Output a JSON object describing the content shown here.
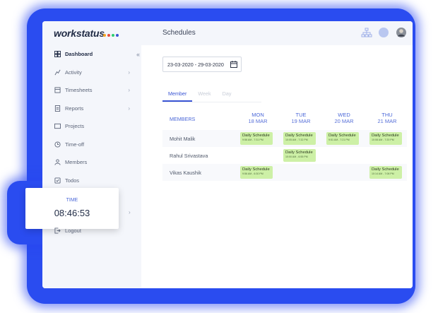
{
  "brand": {
    "logo_text": "workstatus",
    "dot_colors": [
      "#f5a623",
      "#e74c3c",
      "#2ecc71",
      "#3a55d4"
    ]
  },
  "colors": {
    "accent": "#3a55d4",
    "glow": "#2a4cf0",
    "schedule_chip": "#cdf0a6"
  },
  "sidebar": {
    "items": [
      {
        "label": "Dashboard",
        "icon": "dashboard-icon",
        "active": true
      },
      {
        "label": "Activity",
        "icon": "activity-icon",
        "chevron": true
      },
      {
        "label": "Timesheets",
        "icon": "timesheet-icon",
        "chevron": true
      },
      {
        "label": "Reports",
        "icon": "report-icon",
        "chevron": true
      },
      {
        "label": "Projects",
        "icon": "folder-icon"
      },
      {
        "label": "Time-off",
        "icon": "clock-icon"
      },
      {
        "label": "Members",
        "icon": "user-icon"
      },
      {
        "label": "Todos",
        "icon": "todo-icon"
      }
    ],
    "logout": "Logout"
  },
  "header": {
    "title": "Schedules"
  },
  "filters": {
    "date_range": "23-03-2020 - 29-03-2020"
  },
  "view_tabs": [
    "Member",
    "Week",
    "Day"
  ],
  "table": {
    "members_header": "MEMBERS",
    "days": [
      {
        "name": "MON",
        "date": "18 MAR"
      },
      {
        "name": "TUE",
        "date": "19 MAR"
      },
      {
        "name": "WED",
        "date": "20 MAR"
      },
      {
        "name": "THU",
        "date": "21 MAR"
      }
    ],
    "rows": [
      {
        "member": "Mohit Malik"
      },
      {
        "member": "Rahul Srivastava"
      },
      {
        "member": "Vikas Kaushik"
      }
    ],
    "schedules": [
      {
        "row": 0,
        "day": 0,
        "label": "Daily Schedule",
        "time": "9:56 AM - 7:31 PM"
      },
      {
        "row": 0,
        "day": 1,
        "label": "Daily Schedule",
        "time": "10:05 AM - 7:32 PM"
      },
      {
        "row": 0,
        "day": 2,
        "label": "Daily Schedule",
        "time": "9:51 AM - 7:21 PM"
      },
      {
        "row": 0,
        "day": 3,
        "label": "Daily Schedule",
        "time": "10:08 AM - 7:20 PM"
      },
      {
        "row": 1,
        "day": 1,
        "label": "Daily Schedule",
        "time": "10:00 AM - 6:55 PM"
      },
      {
        "row": 2,
        "day": 0,
        "label": "Daily Schedule",
        "time": "9:56 AM - 6:30 PM"
      },
      {
        "row": 2,
        "day": 3,
        "label": "Daily Schedule",
        "time": "10:14 AM - 7:08 PM"
      }
    ]
  },
  "time_card": {
    "label": "TIME",
    "value": "08:46:53"
  }
}
